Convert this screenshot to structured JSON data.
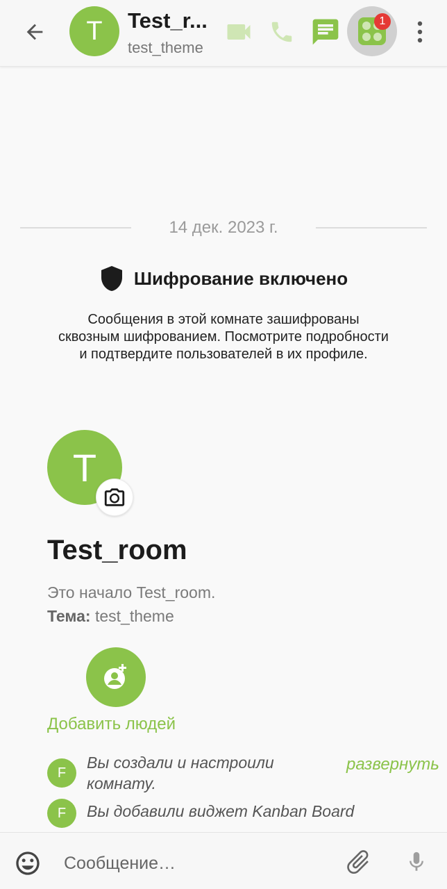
{
  "header": {
    "avatar_letter": "T",
    "title": "Test_r...",
    "subtitle": "test_theme",
    "widgets_badge": "1",
    "icons": [
      "back-arrow-icon",
      "video-call-icon",
      "phone-icon",
      "chat-icon",
      "widgets-icon",
      "more-vert-icon"
    ]
  },
  "timeline": {
    "date_separator": "14 дек. 2023 г.",
    "encryption": {
      "title": "Шифрование включено",
      "description": "Сообщения в этой комнате зашифрованы сквозным шифрованием. Посмотрите подробности и подтвердите пользователей в их профиле."
    },
    "room_intro": {
      "avatar_letter": "T",
      "name": "Test_room",
      "beginning_text": "Это начало Test_room.",
      "topic_label": "Тема:",
      "topic_value": "test_theme",
      "add_people_label": "Добавить людей"
    },
    "events": [
      {
        "avatar_letter": "F",
        "text_line1": "Вы создали и настроили",
        "text_line2": "комнату."
      },
      {
        "avatar_letter": "F",
        "text_line1": "Вы добавили виджет Kanban Board"
      }
    ],
    "expand_label": "развернуть"
  },
  "composer": {
    "placeholder": "Сообщение…"
  },
  "colors": {
    "accent": "#8bc34a",
    "badge": "#e53935"
  }
}
